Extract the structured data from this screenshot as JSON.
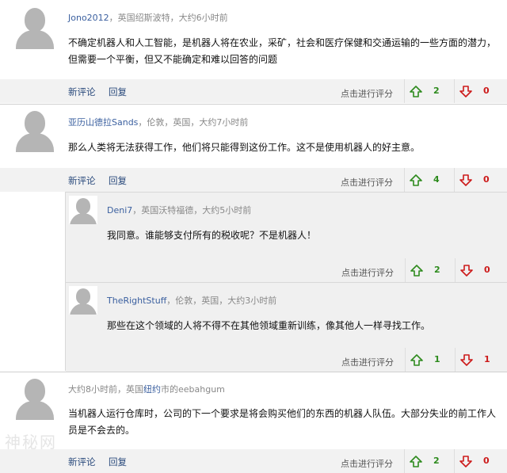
{
  "comments": [
    {
      "user": "Jono2012",
      "location": "，英国绍斯波特，大约6小时前",
      "text": "不确定机器人和人工智能，是机器人将在农业，采矿，社会和医疗保健和交通运输的一些方面的潜力，但需要一个平衡，但又不能确定和难以回答的问题",
      "new_comment": "新评论",
      "reply": "回复",
      "rate": "点击进行评分",
      "up": "2",
      "down": "0"
    },
    {
      "user": "亚历山德拉Sands",
      "location": "，伦敦，英国，大约7小时前",
      "text": "那么人类将无法获得工作，他们将只能得到这份工作。这不是使用机器人的好主意。",
      "new_comment": "新评论",
      "reply": "回复",
      "rate": "点击进行评分",
      "up": "4",
      "down": "0"
    }
  ],
  "replies": [
    {
      "user": "Deni7",
      "location": "，英国沃特福德，大约5小时前",
      "text": "我同意。谁能够支付所有的税收呢？不是机器人！",
      "rate": "点击进行评分",
      "up": "2",
      "down": "0"
    },
    {
      "user": "TheRightStuff",
      "location": "，伦敦，英国，大约3小时前",
      "text": "那些在这个领域的人将不得不在其他领域重新训练，像其他人一样寻找工作。",
      "rate": "点击进行评分",
      "up": "1",
      "down": "1"
    }
  ],
  "last_comment": {
    "meta_prefix": "大约8小时前，英国",
    "meta_link": "纽约",
    "meta_suffix": "市的eebahgum",
    "text": "当机器人运行仓库时，公司的下一个要求是将会购买他们的东西的机器人队伍。大部分失业的前工作人员是不会去的。",
    "new_comment": "新评论",
    "reply": "回复",
    "rate": "点击进行评分",
    "up": "2",
    "down": "0"
  },
  "watermark": "神秘网",
  "colors": {
    "up": "#2e8b1e",
    "down": "#cc1a1a",
    "link": "#3a5f9f"
  },
  "icons": {
    "up": "arrow-up-icon",
    "down": "arrow-down-icon",
    "avatar": "default-avatar-icon"
  }
}
